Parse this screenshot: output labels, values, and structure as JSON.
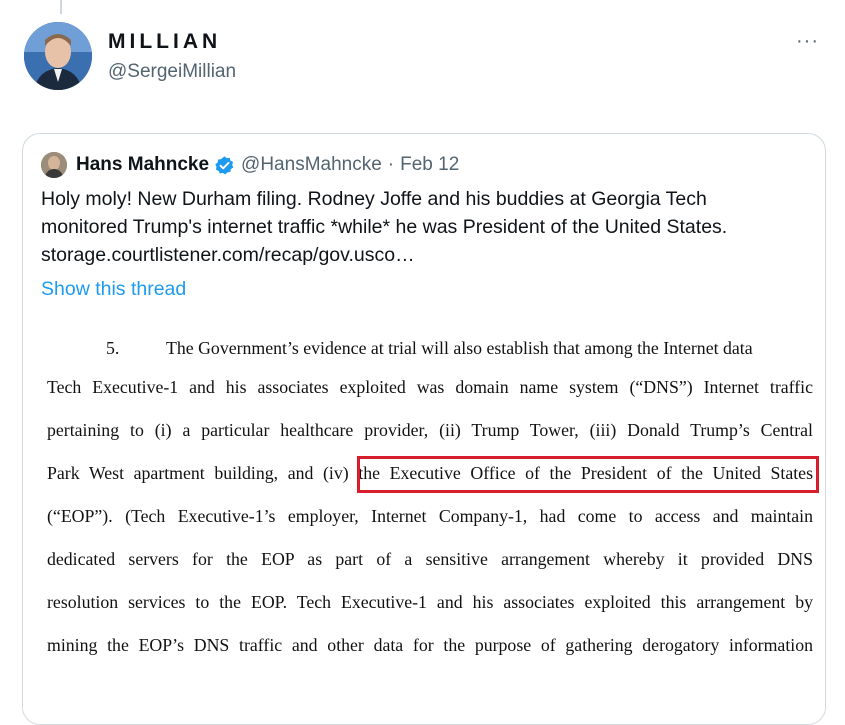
{
  "tweet": {
    "author_name": "MILLIAN",
    "author_handle": "@SergeiMillian",
    "more_label": "···"
  },
  "quote": {
    "author_name": "Hans Mahncke",
    "author_handle": "@HansMahncke",
    "separator": "·",
    "date": "Feb 12",
    "text_lines": [
      "Holy moly! New Durham filing. Rodney Joffe and his buddies at Georgia Tech",
      "monitored Trump's internet traffic *while* he was President of the United States.",
      "storage.courtlistener.com/recap/gov.usco…"
    ],
    "show_thread": "Show this thread",
    "verified_color": "#1d9bf0"
  },
  "document": {
    "paragraph_number": "5.",
    "lines": [
      "The Government’s evidence at trial will also establish that among the Internet data",
      "Tech Executive-1 and his associates exploited was domain name system (“DNS”) Internet traffic",
      "pertaining to (i) a particular healthcare provider, (ii) Trump Tower, (iii) Donald Trump’s Central",
      "Park West apartment building, and (iv) the Executive Office of the President of the United States",
      "(“EOP”).  (Tech Executive-1’s employer, Internet Company-1, had come to access and maintain",
      "dedicated servers for the EOP as part of a sensitive arrangement whereby it provided DNS",
      "resolution services to the EOP.  Tech Executive-1 and his associates exploited this arrangement by",
      "mining the EOP’s DNS traffic and other data for the purpose of gathering derogatory information"
    ],
    "highlight_color": "#d81e2c"
  }
}
